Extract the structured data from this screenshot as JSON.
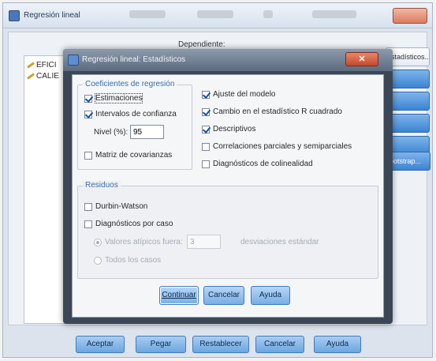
{
  "outer_window": {
    "title": "Regresión lineal",
    "dependent_label": "Dependiente:",
    "variables": [
      "EFICI",
      "CALIE"
    ],
    "side_buttons": [
      "Estadísticos...",
      "",
      "",
      "",
      "",
      "Bootstrap..."
    ],
    "buttons": {
      "ok": "Aceptar",
      "paste": "Pegar",
      "reset": "Restablecer",
      "cancel": "Cancelar",
      "help": "Ayuda"
    }
  },
  "dialog": {
    "title": "Regresión lineal: Estadísticos",
    "coefficients": {
      "title": "Coeficientes de regresión",
      "estimates": {
        "label": "Estimaciones",
        "checked": true
      },
      "confidence_intervals": {
        "label": "Intervalos de confianza",
        "checked": true
      },
      "level_label": "Nivel (%):",
      "level_value": "95",
      "covariance_matrix": {
        "label": "Matriz de covarianzas",
        "checked": false
      }
    },
    "right_options": {
      "model_fit": {
        "label": "Ajuste del modelo",
        "checked": true
      },
      "r_squared_change": {
        "label": "Cambio en el estadístico R cuadrado",
        "checked": true
      },
      "descriptives": {
        "label": "Descriptivos",
        "checked": true
      },
      "part_partial": {
        "label": "Correlaciones parciales y semiparciales",
        "checked": false
      },
      "collinearity": {
        "label": "Diagnósticos de colinealidad",
        "checked": false
      }
    },
    "residuals": {
      "title": "Residuos",
      "durbin_watson": {
        "label": "Durbin-Watson",
        "checked": false
      },
      "casewise": {
        "label": "Diagnósticos por caso",
        "checked": false
      },
      "outliers_label": "Valores atípicos fuera:",
      "outliers_value": "3",
      "outliers_units": "desviaciones estándar",
      "all_cases_label": "Todos los casos"
    },
    "buttons": {
      "continue": "Continuar",
      "cancel": "Cancelar",
      "help": "Ayuda"
    }
  },
  "colors": {
    "accent": "#3b84d2",
    "dialog_frame": "#3b4756",
    "group_title": "#3b6ea8"
  }
}
